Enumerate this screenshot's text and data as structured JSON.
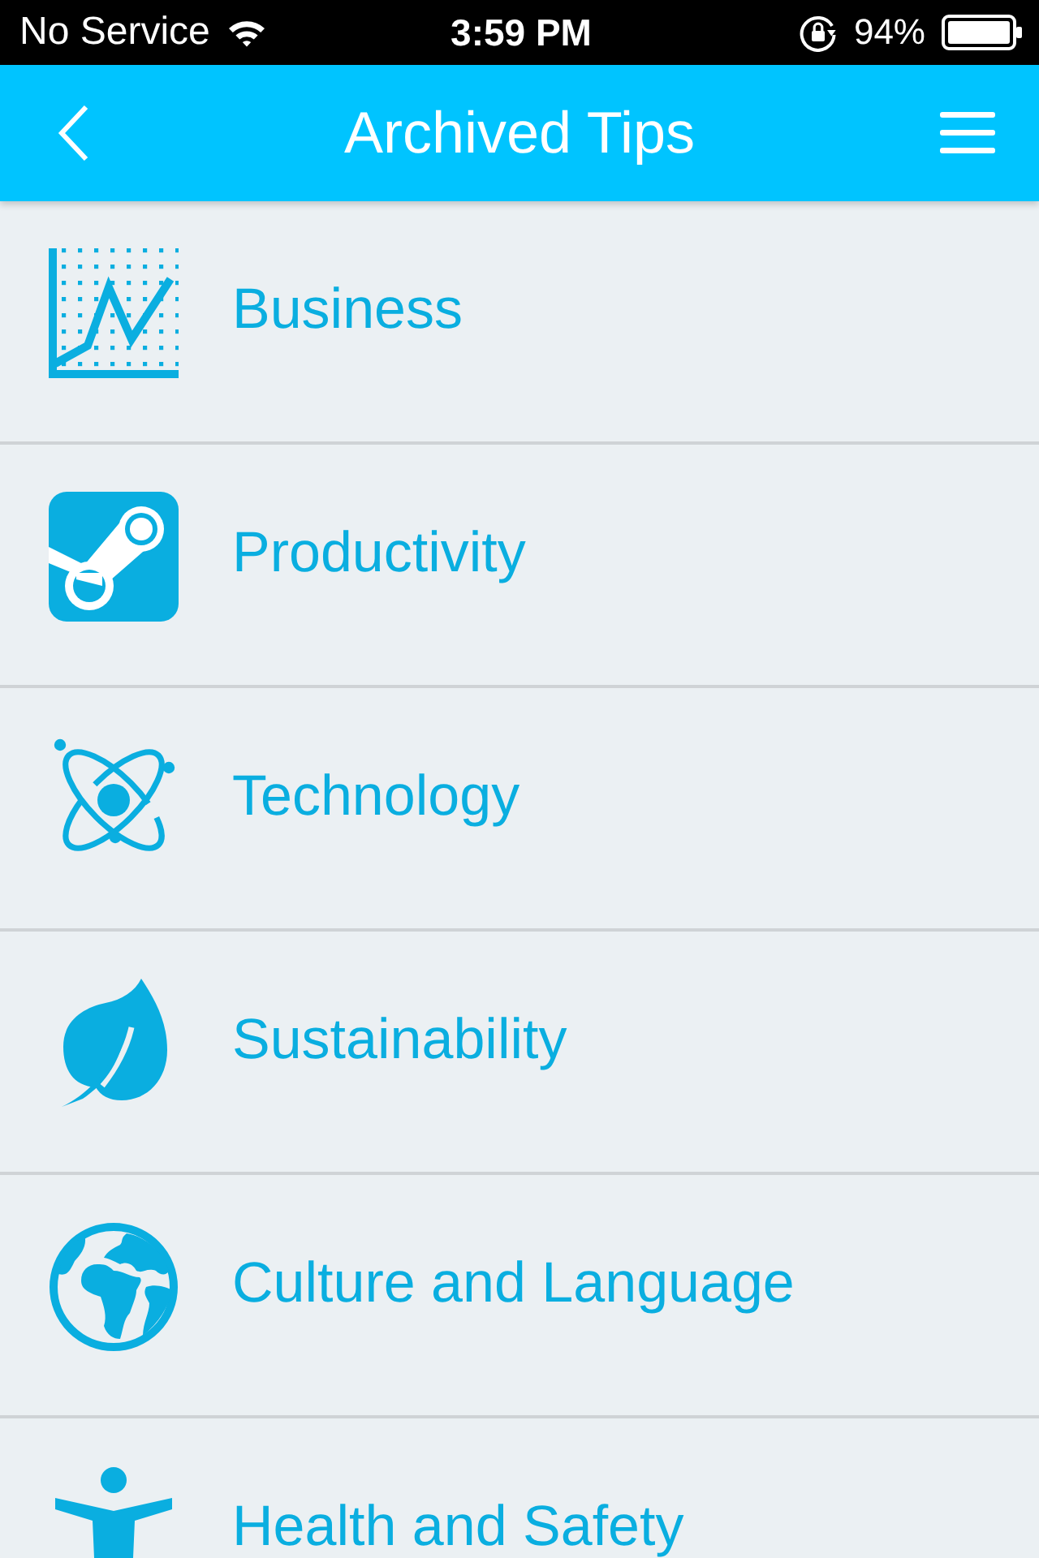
{
  "status_bar": {
    "carrier": "No Service",
    "time": "3:59 PM",
    "battery": "94%"
  },
  "nav_bar": {
    "title": "Archived Tips"
  },
  "categories": [
    {
      "label": "Business"
    },
    {
      "label": "Productivity"
    },
    {
      "label": "Technology"
    },
    {
      "label": "Sustainability"
    },
    {
      "label": "Culture and Language"
    },
    {
      "label": "Health and Safety"
    }
  ]
}
